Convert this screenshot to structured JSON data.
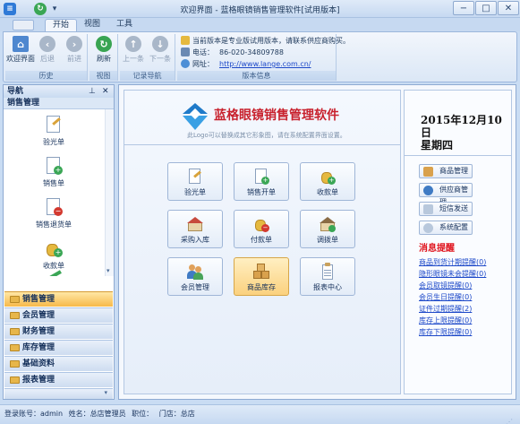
{
  "window": {
    "title": "欢迎界面 - 蓝格眼镜销售管理软件[试用版本]",
    "buttons": [
      "min",
      "max",
      "close"
    ]
  },
  "ribbon_tabs": [
    "开始",
    "视图",
    "工具"
  ],
  "ribbon": {
    "groups": {
      "history": {
        "label": "历史",
        "buttons": [
          "欢迎界面",
          "后退",
          "前进"
        ]
      },
      "view": {
        "label": "视图",
        "buttons": [
          "刷新"
        ]
      },
      "records": {
        "label": "记录导航",
        "buttons": [
          "上一条",
          "下一条"
        ]
      },
      "info": {
        "label": "版本信息",
        "notice": "当前版本是专业版试用版本，请联系供应商购买。",
        "phone_label": "电话：",
        "phone": "86-020-34809788",
        "site_label": "网址：",
        "site": "http://www.lange.com.cn/"
      }
    }
  },
  "nav": {
    "header": "导航",
    "header_buttons": [
      "pin",
      "close"
    ],
    "section": "销售管理",
    "items": [
      "验光单",
      "销售单",
      "销售退货单",
      "收款单"
    ],
    "categories": [
      "销售管理",
      "会员管理",
      "财务管理",
      "库存管理",
      "基础资料",
      "报表管理"
    ],
    "active_category": "销售管理"
  },
  "main": {
    "brand": "蓝格眼镜销售管理软件",
    "brand_hint": "此Logo可以替换成其它形象图，请在系统配置界面设置。",
    "tiles": [
      "验光单",
      "销售开单",
      "收款单",
      "采购入库",
      "付款单",
      "调拨单",
      "会员管理",
      "商品库存",
      "报表中心"
    ],
    "active_tile": "商品库存",
    "date_line1": "2015年12月10日",
    "date_line2": "星期四",
    "quick_buttons": [
      "商品管理",
      "供应商管理",
      "短信发送",
      "系统配置"
    ],
    "msg_title": "消息提醒",
    "messages": [
      "商品到货计期提醒(0)",
      "隐形眼镜未会提醒(0)",
      "会员取镜提醒(0)",
      "会员生日提醒(0)",
      "证件过期提醒(2)",
      "库存上限提醒(0)",
      "库存下限提醒(0)"
    ]
  },
  "status": {
    "account_label": "登录账号：",
    "account": "admin",
    "name_label": "姓名：",
    "name": "总店管理员",
    "position_label": "职位：",
    "position": "",
    "store_label": "门店：",
    "store": "总店"
  },
  "colors": {
    "accent_red": "#c8212d",
    "link_blue": "#1b47c8",
    "active_orange": "#f7b94a"
  }
}
